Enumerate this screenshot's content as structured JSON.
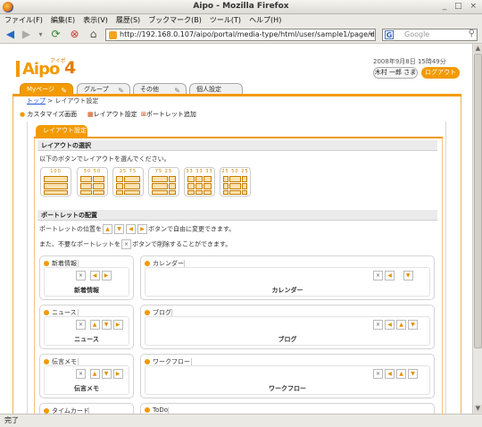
{
  "window": {
    "title": "Aipo - Mozilla Firefox"
  },
  "menu": [
    "ファイル(F)",
    "編集(E)",
    "表示(V)",
    "履歴(S)",
    "ブックマーク(B)",
    "ツール(T)",
    "ヘルプ(H)"
  ],
  "nav": {
    "url": "http://192.168.0.107/aipo/portal/media-type/html/user/sample1/page/de",
    "search_placeholder": "Google"
  },
  "header": {
    "logo": "Aipo",
    "logo_ruby": "アイポ",
    "logo_num": "4",
    "date": "2008年9月8日 15時49分",
    "user": "木村 一郎 さま",
    "logout": "ログアウト"
  },
  "tabs": [
    {
      "label": "Myページ"
    },
    {
      "label": "グループ"
    },
    {
      "label": "その他"
    },
    {
      "label": "個人設定"
    }
  ],
  "breadcrumb": {
    "top": "トップ",
    "sep": ">",
    "current": "レイアウト設定"
  },
  "toolbar": {
    "customize": "カスタマイズ画面",
    "layout": "レイアウト設定",
    "add": "ポートレット追加"
  },
  "subtab": "レイアウト設定",
  "layout_section": {
    "title": "レイアウトの選択",
    "desc": "以下のボタンでレイアウトを選んでください。",
    "options": [
      {
        "label": "100"
      },
      {
        "label": "50 50"
      },
      {
        "label": "25 75"
      },
      {
        "label": "75 25"
      },
      {
        "label": "33 33 33"
      },
      {
        "label": "25 50 25"
      }
    ]
  },
  "portlet_section": {
    "title": "ポートレットの配置",
    "desc1a": "ポートレットの位置を",
    "desc1b": "ボタンで自由に変更できます。",
    "desc2a": "また、不要なポートレットを",
    "desc2b": "ボタンで削除することができます。"
  },
  "portlets": {
    "left": [
      {
        "title": "新着情報",
        "name": "新着情報"
      },
      {
        "title": "ニュース",
        "name": "ニュース"
      },
      {
        "title": "伝言メモ",
        "name": "伝言メモ"
      },
      {
        "title": "タイムカード",
        "name": ""
      }
    ],
    "right": [
      {
        "title": "カレンダー",
        "name": "カレンダー"
      },
      {
        "title": "ブログ",
        "name": "ブログ"
      },
      {
        "title": "ワークフロー",
        "name": "ワークフロー"
      },
      {
        "title": "ToDo",
        "name": ""
      }
    ]
  },
  "glyphs": {
    "x": "×",
    "up": "▲",
    "down": "▼",
    "left": "◀",
    "right": "▶"
  },
  "status": "完了",
  "colors": {
    "accent": "#f29a00",
    "link": "#225ad8"
  }
}
